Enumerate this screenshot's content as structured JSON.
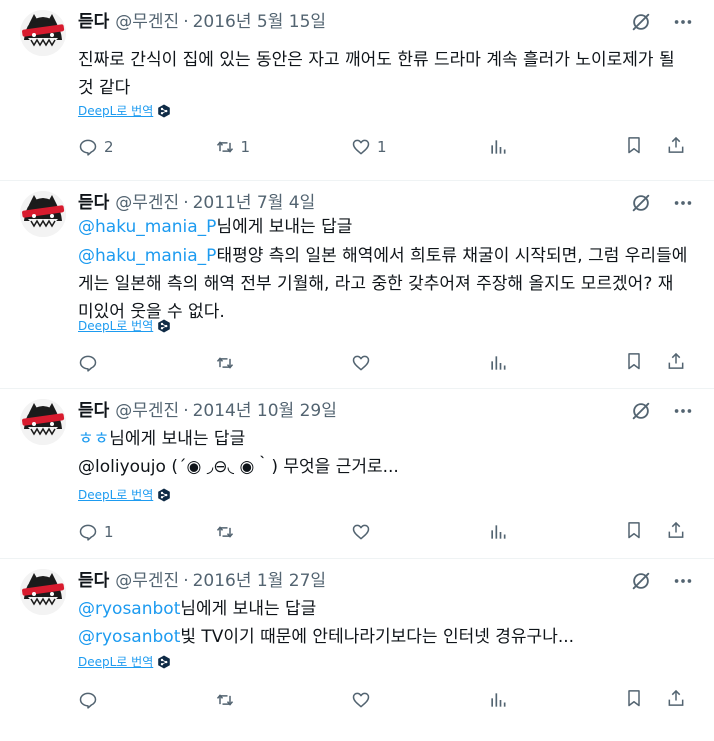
{
  "tweets": [
    {
      "name": "듣다",
      "handle": "@무겐진",
      "dot": "·",
      "date": "2016년 5월 15일",
      "reply_label": "",
      "mention": "",
      "text_line1": "진짜로 간식이 집에 있는 동안은 자고 깨어도 한류 드라마 계속 흘러가 노이로제가 될",
      "text_line2": "것 같다",
      "translate_label": "DeepL로 번역",
      "replies": "2",
      "retweets": "1",
      "likes": "1"
    },
    {
      "name": "듣다",
      "handle": "@무겐진",
      "dot": "·",
      "date": "2011년 7월 4일",
      "reply_mention": "@haku_mania_P",
      "reply_suffix": "님에게 보내는 답글",
      "mention": "@haku_mania_P",
      "text_line1": "태평양 측의 일본 해역에서 희토류 채굴이 시작되면, 그럼 우리들에",
      "text_line2": "게는 일본해 측의 해역 전부 기월해, 라고 중한 갖추어져 주장해 올지도 모르겠어? 재",
      "text_line3": "미있어 웃을 수 없다.",
      "translate_label": "DeepL로 번역",
      "replies": "",
      "retweets": "",
      "likes": ""
    },
    {
      "name": "듣다",
      "handle": "@무겐진",
      "dot": "·",
      "date": "2014년 10월 29일",
      "reply_mention": "ㅎㅎ",
      "reply_suffix": "님에게 보내는 답글",
      "text_line1": "@loliyoujo (´◉ ◞⊖◟ ◉｀) 무엇을 근거로...",
      "translate_label": "DeepL로 번역",
      "replies": "1",
      "retweets": "",
      "likes": ""
    },
    {
      "name": "듣다",
      "handle": "@무겐진",
      "dot": "·",
      "date": "2016년 1월 27일",
      "reply_mention": "@ryosanbot",
      "reply_suffix": "님에게 보내는 답글",
      "mention": "@ryosanbot",
      "text_line1": "빛 TV이기 때문에 안테나라기보다는 인터넷 경유구나...",
      "translate_label": "DeepL로 번역",
      "replies": "",
      "retweets": "",
      "likes": ""
    }
  ],
  "icons": {
    "grok": "grok-icon",
    "more": "more-icon",
    "reply": "reply-icon",
    "retweet": "retweet-icon",
    "like": "like-icon",
    "views": "views-icon",
    "bookmark": "bookmark-icon",
    "share": "share-icon",
    "deepl": "deepl-logo-icon"
  },
  "colors": {
    "text": "#0f1419",
    "secondary": "#536471",
    "link": "#1d9bf0",
    "divider": "#eff3f4"
  }
}
